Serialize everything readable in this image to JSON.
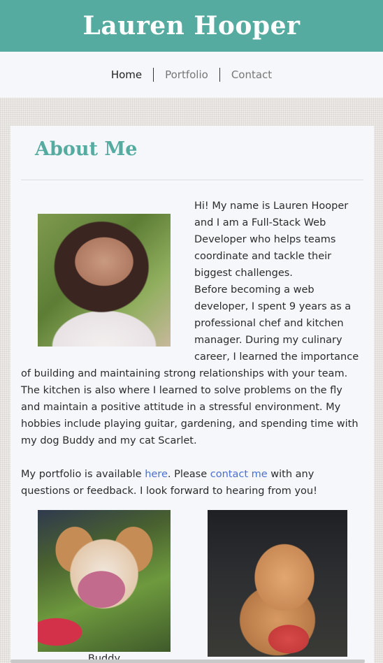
{
  "header": {
    "title": "Lauren Hooper",
    "background_color": "#55aba0"
  },
  "nav": {
    "items": [
      {
        "label": "Home",
        "active": true
      },
      {
        "label": "Portfolio",
        "active": false
      },
      {
        "label": "Contact",
        "active": false
      }
    ]
  },
  "about": {
    "title": "About Me",
    "bio_1": "Hi! My name is Lauren Hooper and I am a Full-Stack Web Developer who helps teams coordinate and tackle their biggest challenges.",
    "bio_2": "Before becoming a web developer, I spent 9 years as a professional chef and kitchen manager. During my culinary career, I learned the importance of building and maintaining strong relationships with your team. The kitchen is also where I learned to solve problems on the fly and maintain a positive attitude in a stressful environment. My hobbies include playing guitar, gardening, and spending time with my dog Buddy and my cat Scarlet.",
    "portfolio_prefix": "My portfolio is available ",
    "portfolio_link": "here",
    "portfolio_middle": ". Please ",
    "contact_link": "contact me",
    "portfolio_suffix": " with any questions or feedback. I look forward to hearing from you!"
  },
  "pets": {
    "dog_caption": "Buddy"
  },
  "colors": {
    "accent": "#55aba0",
    "link": "#4a6fd0"
  }
}
